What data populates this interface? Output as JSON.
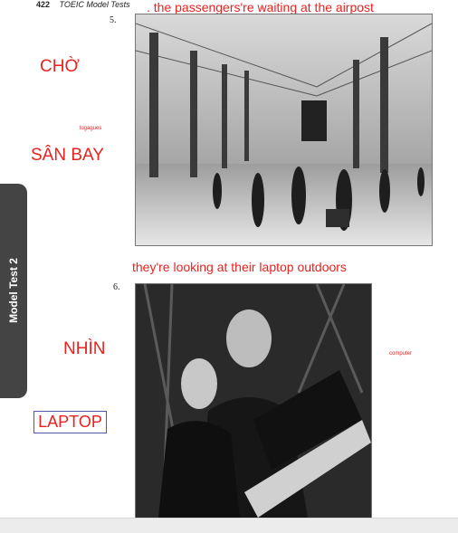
{
  "header": {
    "page_number": "422",
    "book_title": "TOEIC Model Tests"
  },
  "questions": [
    {
      "number": "5.",
      "caption": ". the passengers're waiting at the airpost"
    },
    {
      "number": "6.",
      "caption": "they're looking at their laptop outdoors"
    }
  ],
  "vocab": {
    "cho": "CHỜ",
    "san_bay": "SÂN BAY",
    "luggages": "lugagues",
    "nhin": "NHÌN",
    "laptop": "LAPTOP",
    "computer": "computer"
  },
  "side_tab": "Model Test 2"
}
